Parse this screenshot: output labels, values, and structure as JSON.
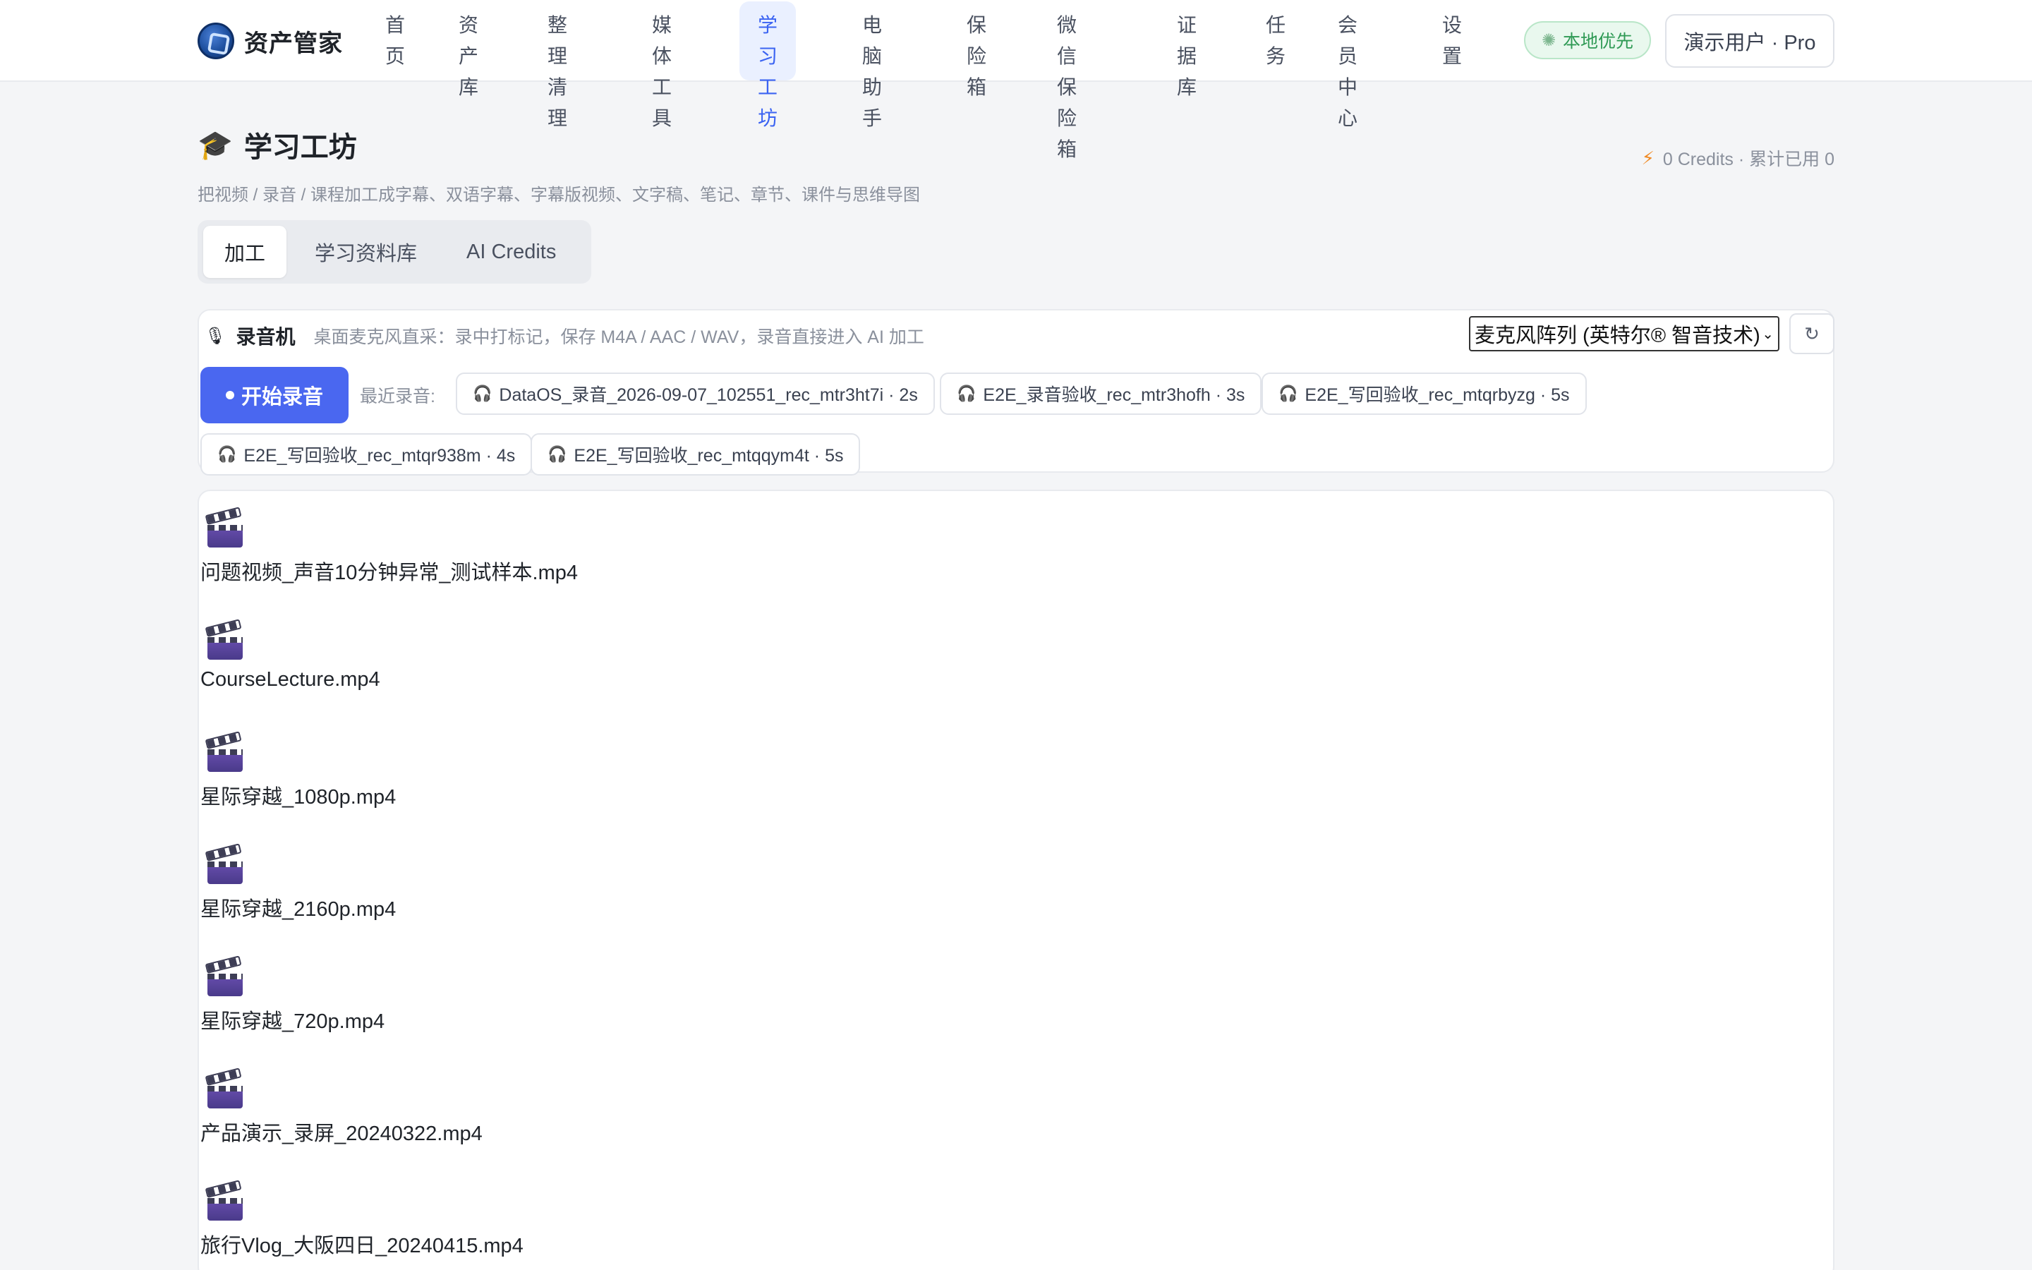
{
  "brand": {
    "name": "资产管家",
    "logo_icon": "shield-logo-icon"
  },
  "nav": {
    "items": [
      {
        "line1": "首",
        "line2": "页"
      },
      {
        "line1": "资产",
        "line2": "库"
      },
      {
        "line1": "整理清",
        "line2": "理"
      },
      {
        "line1": "媒体工",
        "line2": "具"
      },
      {
        "line1": "学习工",
        "line2": "坊",
        "active": true
      },
      {
        "line1": "电脑助",
        "line2": "手"
      },
      {
        "line1": "保险",
        "line2": "箱"
      },
      {
        "line1": "微信保",
        "line2": "险箱"
      },
      {
        "line1": "证据",
        "line2": "库"
      },
      {
        "line1": "任",
        "line2": "务"
      },
      {
        "line1": "会员中",
        "line2": "心"
      },
      {
        "line1": "设",
        "line2": "置"
      }
    ],
    "active_color": "#3b63f2"
  },
  "local_badge": "本地优先",
  "user_button": "演示用户 · Pro",
  "page": {
    "title": "学习工坊",
    "subtitle": "把视频 / 录音 / 课程加工成字幕、双语字幕、字幕版视频、文字稿、笔记、章节、课件与思维导图",
    "credits": "0 Credits · 累计已用 0"
  },
  "tabs": [
    "加工",
    "学习资料库",
    "AI Credits"
  ],
  "recorder": {
    "title": "录音机",
    "description": "桌面麦克风直采：录中打标记，保存 M4A / AAC / WAV，录音直接进入 AI 加工",
    "mic_select": "麦克风阵列 (英特尔® 智音技术)",
    "start_button": "开始录音",
    "recent_label": "最近录音:",
    "recent": [
      "DataOS_录音_2026-09-07_102551_rec_mtr3ht7i · 2s",
      "E2E_录音验收_rec_mtr3hofh · 3s",
      "E2E_写回验收_rec_mtqrbyzg · 5s",
      "E2E_写回验收_rec_mtqr938m · 4s",
      "E2E_写回验收_rec_mtqqym4t · 5s"
    ],
    "accent_color": "#4a67f0"
  },
  "files": [
    "问题视频_声音10分钟异常_测试样本.mp4",
    "CourseLecture.mp4",
    "星际穿越_1080p.mp4",
    "星际穿越_2160p.mp4",
    "星际穿越_720p.mp4",
    "产品演示_录屏_20240322.mp4",
    "旅行Vlog_大阪四日_20240415.mp4"
  ]
}
